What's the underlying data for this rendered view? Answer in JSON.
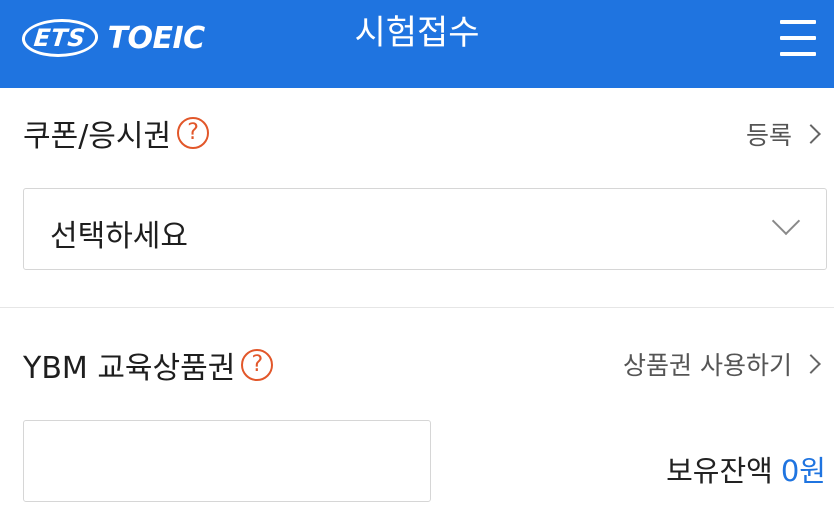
{
  "header": {
    "logo_ets": "ETS",
    "logo_toeic": "TOEIC",
    "title": "시험접수"
  },
  "coupon": {
    "title": "쿠폰/응시권",
    "help": "?",
    "link_label": "등록",
    "select_value": "선택하세요"
  },
  "voucher": {
    "title": "YBM 교육상품권",
    "help": "?",
    "link_label": "상품권 사용하기",
    "input_value": "",
    "balance_label": "보유잔액",
    "balance_amount": "0원"
  },
  "colors": {
    "header_bg": "#1f74e0",
    "help_icon": "#e2572a",
    "amount": "#1f74e0"
  },
  "icons": [
    "hamburger-menu-icon",
    "help-circle-icon",
    "chevron-right-icon",
    "chevron-down-icon"
  ]
}
